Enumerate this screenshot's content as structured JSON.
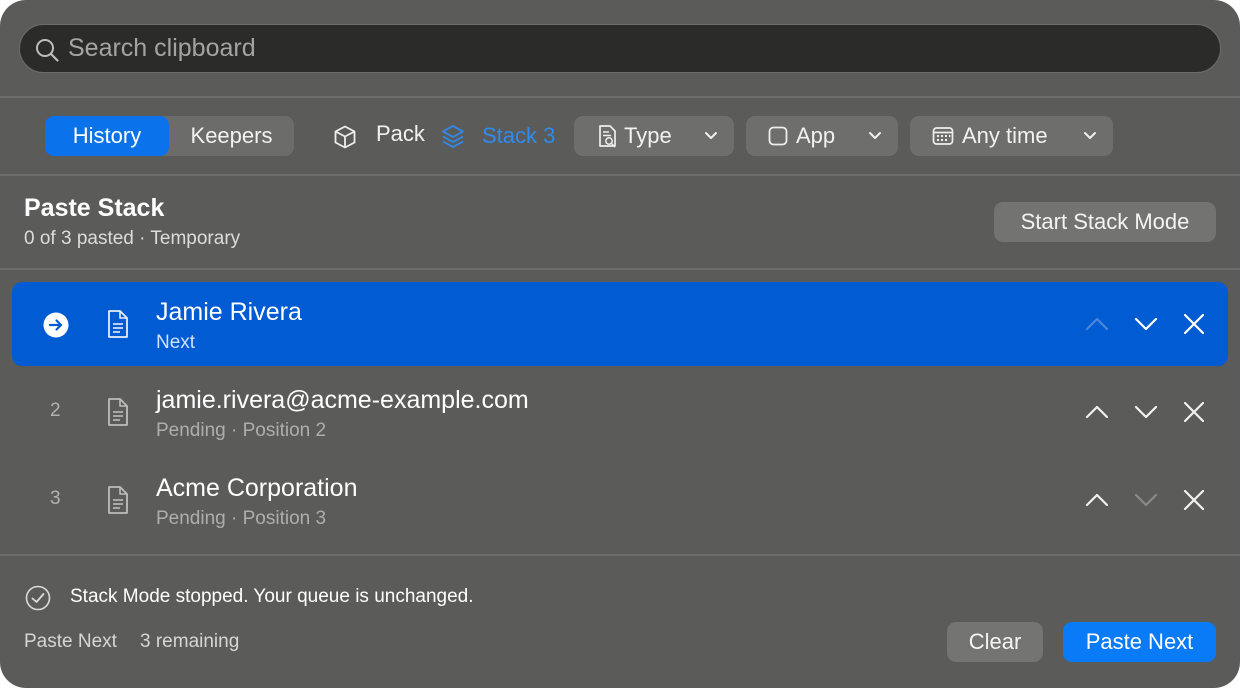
{
  "search": {
    "placeholder": "Search clipboard",
    "value": ""
  },
  "tabs": [
    {
      "label": "History",
      "active": true
    },
    {
      "label": "Keepers",
      "active": false
    }
  ],
  "toolbar": {
    "pack_label": "Pack",
    "stack_label": "Stack 3",
    "type_label": "Type",
    "app_label": "App",
    "time_label": "Any time"
  },
  "header": {
    "title": "Paste Stack",
    "subtitle": "0 of 3 pasted · Temporary",
    "start_label": "Start Stack Mode"
  },
  "rows": [
    {
      "index": "",
      "name": "Jamie Rivera",
      "meta": "Next",
      "selected": true,
      "can_move_up": false,
      "can_move_down": true
    },
    {
      "index": "2",
      "name": "jamie.rivera@acme-example.com",
      "meta": "Pending · Position 2",
      "selected": false,
      "can_move_up": true,
      "can_move_down": true
    },
    {
      "index": "3",
      "name": "Acme Corporation",
      "meta": "Pending · Position 3",
      "selected": false,
      "can_move_up": true,
      "can_move_down": false
    }
  ],
  "footer": {
    "status": "Stack Mode stopped. Your queue is unchanged.",
    "paste_next_hint": "Paste Next",
    "remaining": "3 remaining",
    "clear_label": "Clear",
    "paste_label": "Paste Next"
  },
  "colors": {
    "accent": "#0a7bf6",
    "selection": "#015bd3",
    "stack_accent": "#2f8bf0",
    "panel": "#5b5b5a"
  },
  "icons": [
    "search-icon",
    "cube-icon",
    "layers-icon",
    "doc-search-icon",
    "chevron-down-icon",
    "checkbox-icon",
    "calendar-icon",
    "arrow-circle-icon",
    "document-icon",
    "chevron-up-icon",
    "close-icon",
    "check-circle-icon"
  ]
}
